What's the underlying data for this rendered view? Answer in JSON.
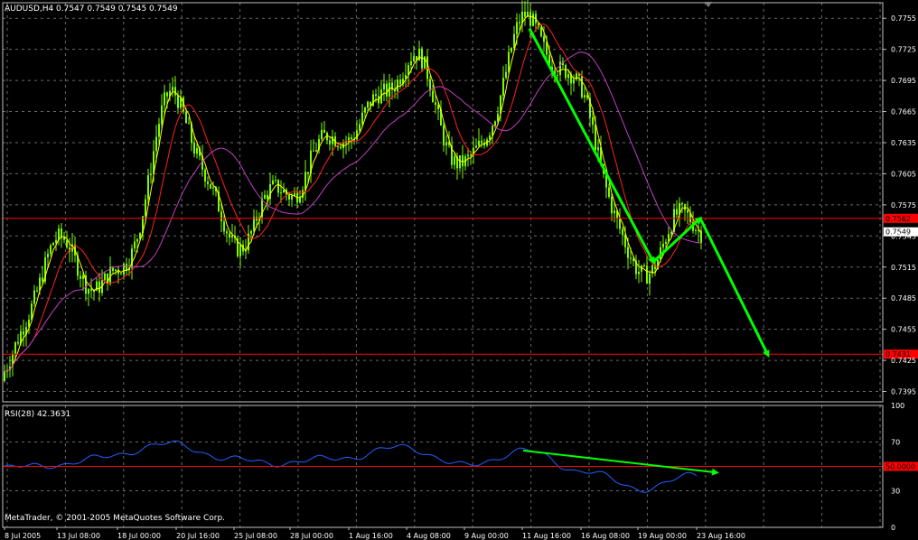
{
  "header": {
    "symbol_text": "AUDUSD,H4",
    "ohlc_text": "0.7547 0.7549 0.7545 0.7549"
  },
  "rsi_panel": {
    "title_text": "RSI(28) 42.3631",
    "levels": [
      "100",
      "70",
      "50",
      "30",
      "0"
    ],
    "marker_value": "50.0000"
  },
  "copyright_text": "MetaTrader, © 2001-2005 MetaQuotes Software Corp.",
  "price_axis": {
    "labels": [
      "0.7755",
      "0.7725",
      "0.7695",
      "0.7665",
      "0.7635",
      "0.7605",
      "0.7575",
      "0.7545",
      "0.7515",
      "0.7485",
      "0.7455",
      "0.7425",
      "0.7395"
    ],
    "current_price": "0.7549",
    "resistance_value": "0.7562",
    "target_value": "0.7431"
  },
  "time_axis": {
    "labels": [
      "8 Jul 2005",
      "13 Jul 08:00",
      "18 Jul 00:00",
      "20 Jul 16:00",
      "25 Jul 08:00",
      "28 Jul 00:00",
      "1 Aug 16:00",
      "4 Aug 08:00",
      "9 Aug 00:00",
      "11 Aug 16:00",
      "16 Aug 08:00",
      "19 Aug 00:00",
      "23 Aug 16:00"
    ]
  },
  "colors": {
    "background": "#000000",
    "grid": "#c0c0c0",
    "candles": "#7cfc00",
    "ma_fast": "#ffff00",
    "ma_mid": "#ff2020",
    "ma_slow": "#c040c0",
    "horizontal_lines": "#ff0000",
    "arrows": "#00ff00",
    "rsi_line": "#2060ff"
  },
  "chart_data": [
    {
      "type": "candlestick",
      "symbol": "AUDUSD",
      "timeframe": "H4",
      "x": [
        "8 Jul 2005",
        "13 Jul 08:00",
        "18 Jul 00:00",
        "20 Jul 16:00",
        "25 Jul 08:00",
        "28 Jul 00:00",
        "1 Aug 16:00",
        "4 Aug 08:00",
        "9 Aug 00:00",
        "11 Aug 16:00",
        "16 Aug 08:00",
        "19 Aug 00:00",
        "23 Aug 16:00"
      ],
      "close_path": [
        {
          "x": "8 Jul 2005",
          "y": 0.7405
        },
        {
          "x": "13 Jul 08:00",
          "y": 0.753
        },
        {
          "x": "18 Jul 00:00",
          "y": 0.751
        },
        {
          "x": "20 Jul 16:00",
          "y": 0.7665
        },
        {
          "x": "25 Jul 08:00",
          "y": 0.7555
        },
        {
          "x": "28 Jul 00:00",
          "y": 0.758
        },
        {
          "x": "1 Aug 16:00",
          "y": 0.766
        },
        {
          "x": "4 Aug 08:00",
          "y": 0.7705
        },
        {
          "x": "9 Aug 00:00",
          "y": 0.7615
        },
        {
          "x": "11 Aug 16:00",
          "y": 0.7745
        },
        {
          "x": "16 Aug 08:00",
          "y": 0.7675
        },
        {
          "x": "19 Aug 00:00",
          "y": 0.752
        },
        {
          "x": "23 Aug 16:00",
          "y": 0.7549
        }
      ],
      "ylim": [
        0.7385,
        0.777
      ],
      "horizontal_lines": [
        0.7562,
        0.7431
      ],
      "trend_arrows": [
        {
          "from": {
            "x": "11 Aug 16:00",
            "y": 0.7745
          },
          "to": {
            "x": "19 Aug 00:00",
            "y": 0.752
          }
        },
        {
          "from": {
            "x": "19 Aug 00:00",
            "y": 0.752
          },
          "to": {
            "x": "23 Aug 16:00",
            "y": 0.7562
          }
        },
        {
          "from": {
            "x": "23 Aug 16:00",
            "y": 0.7562
          },
          "to": {
            "x": "after 23 Aug 16:00",
            "y": 0.743
          }
        }
      ]
    },
    {
      "type": "line",
      "title": "RSI(28) 42.3631",
      "ylim": [
        0,
        100
      ],
      "levels": [
        100,
        70,
        50,
        30,
        0
      ],
      "values_path": [
        {
          "x": "8 Jul 2005",
          "y": 48
        },
        {
          "x": "13 Jul 08:00",
          "y": 52
        },
        {
          "x": "20 Jul 16:00",
          "y": 68
        },
        {
          "x": "25 Jul 08:00",
          "y": 55
        },
        {
          "x": "28 Jul 00:00",
          "y": 53
        },
        {
          "x": "1 Aug 16:00",
          "y": 58
        },
        {
          "x": "4 Aug 08:00",
          "y": 66
        },
        {
          "x": "9 Aug 00:00",
          "y": 50
        },
        {
          "x": "11 Aug 16:00",
          "y": 63
        },
        {
          "x": "16 Aug 08:00",
          "y": 47
        },
        {
          "x": "19 Aug 00:00",
          "y": 32
        },
        {
          "x": "23 Aug 16:00",
          "y": 42
        }
      ],
      "trend_arrow": {
        "from": {
          "x": "11 Aug 16:00",
          "y": 63
        },
        "to": {
          "x": "23 Aug 16:00",
          "y": 45
        }
      }
    }
  ]
}
